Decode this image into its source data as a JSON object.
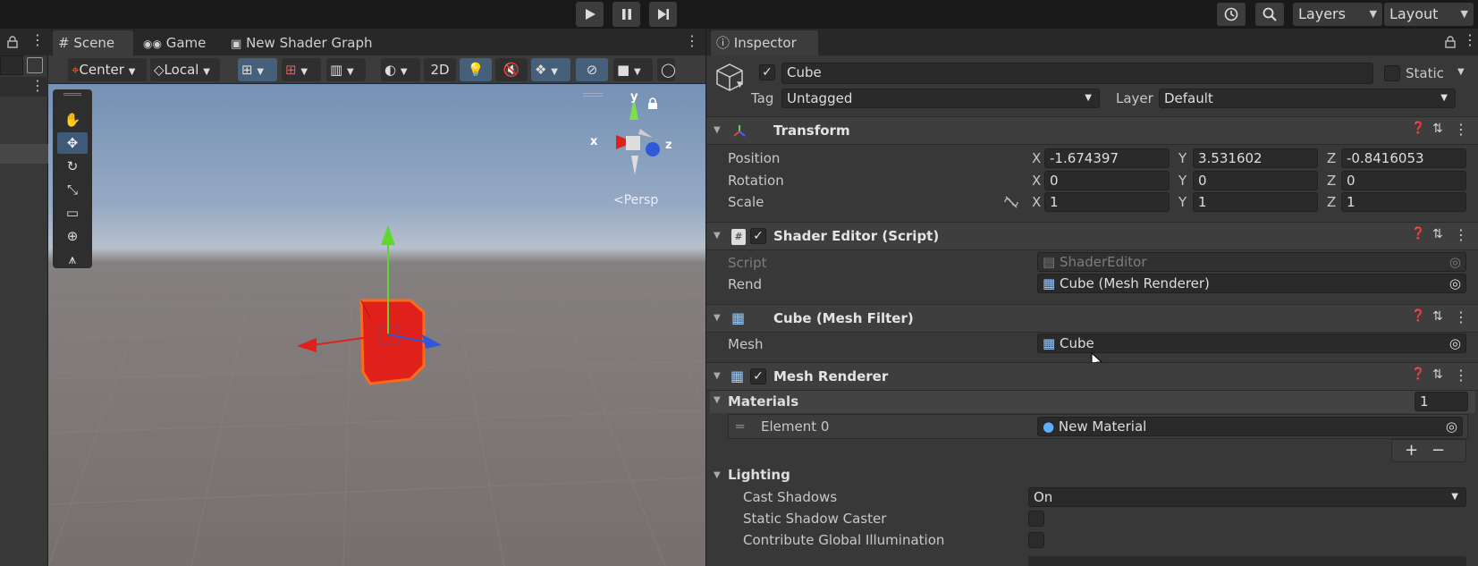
{
  "toolbar": {
    "layers_label": "Layers",
    "layout_label": "Layout"
  },
  "tabs": {
    "scene": "Scene",
    "game": "Game",
    "shader_graph": "New Shader Graph",
    "inspector": "Inspector"
  },
  "scene_toolbar": {
    "pivot": "Center",
    "space": "Local",
    "mode_2d": "2D"
  },
  "viewport": {
    "projection": "Persp",
    "gizmo_x": "x",
    "gizmo_y": "y",
    "gizmo_z": "z"
  },
  "object": {
    "name": "Cube",
    "static_label": "Static",
    "tag_label": "Tag",
    "tag_value": "Untagged",
    "layer_label": "Layer",
    "layer_value": "Default"
  },
  "transform": {
    "title": "Transform",
    "position_label": "Position",
    "rotation_label": "Rotation",
    "scale_label": "Scale",
    "position": {
      "x": "-1.674397",
      "y": "3.531602",
      "z": "-0.8416053"
    },
    "rotation": {
      "x": "0",
      "y": "0",
      "z": "0"
    },
    "scale": {
      "x": "1",
      "y": "1",
      "z": "1"
    },
    "axis_x": "X",
    "axis_y": "Y",
    "axis_z": "Z"
  },
  "shader_editor": {
    "title": "Shader Editor (Script)",
    "script_label": "Script",
    "script_value": "ShaderEditor",
    "rend_label": "Rend",
    "rend_value": "Cube (Mesh Renderer)"
  },
  "mesh_filter": {
    "title": "Cube (Mesh Filter)",
    "mesh_label": "Mesh",
    "mesh_value": "Cube"
  },
  "mesh_renderer": {
    "title": "Mesh Renderer",
    "materials_label": "Materials",
    "materials_count": "1",
    "element0_label": "Element 0",
    "element0_value": "New Material",
    "add": "+",
    "remove": "−",
    "lighting_label": "Lighting",
    "cast_shadows_label": "Cast Shadows",
    "cast_shadows_value": "On",
    "static_shadow_label": "Static Shadow Caster",
    "contribute_gi_label": "Contribute Global Illumination"
  },
  "colors": {
    "accent_blue": "#46607c",
    "panel": "#383838",
    "selected_object": "#e0201a"
  }
}
